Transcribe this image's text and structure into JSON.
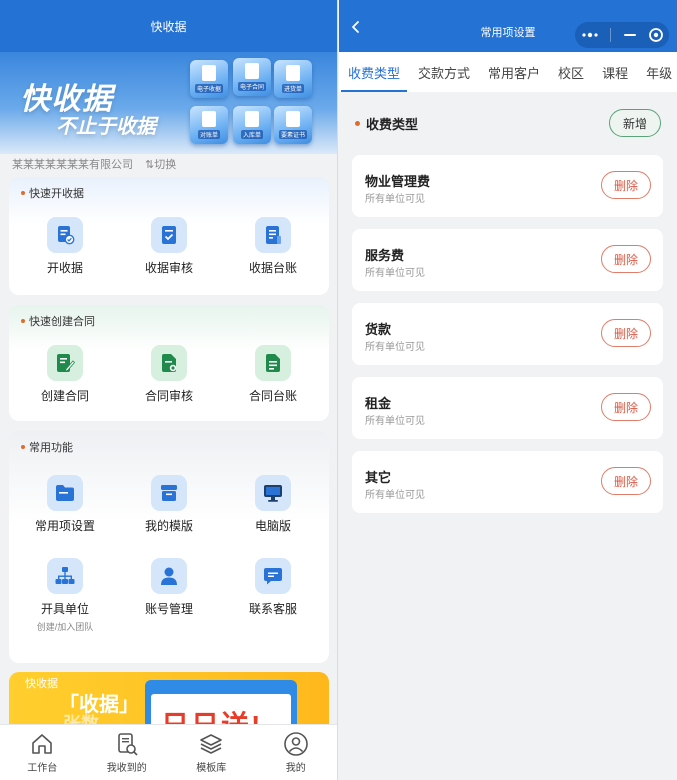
{
  "left": {
    "header_title": "快收据",
    "banner": {
      "title": "快收据",
      "subtitle": "不止于收据",
      "cubes": [
        "电子收据",
        "电子合同",
        "进货单",
        "对账单",
        "入库单",
        "要素证书"
      ]
    },
    "company": {
      "name": "某某某某某某某有限公司",
      "switch_label": "⇅切换"
    },
    "sections": [
      {
        "title": "快速开收据",
        "items": [
          {
            "label": "开收据",
            "icon": "receipt-icon"
          },
          {
            "label": "收据审核",
            "icon": "receipt-check-icon"
          },
          {
            "label": "收据台账",
            "icon": "receipt-ledger-icon"
          }
        ]
      },
      {
        "title": "快速创建合同",
        "items": [
          {
            "label": "创建合同",
            "icon": "contract-create-icon"
          },
          {
            "label": "合同审核",
            "icon": "contract-review-icon"
          },
          {
            "label": "合同台账",
            "icon": "contract-ledger-icon"
          }
        ]
      },
      {
        "title": "常用功能",
        "items": [
          {
            "label": "常用项设置",
            "icon": "folder-icon"
          },
          {
            "label": "我的模版",
            "icon": "template-box-icon"
          },
          {
            "label": "电脑版",
            "icon": "monitor-icon"
          },
          {
            "label": "开具单位",
            "sub": "创建/加入团队",
            "icon": "org-chart-icon"
          },
          {
            "label": "账号管理",
            "icon": "user-icon"
          },
          {
            "label": "联系客服",
            "icon": "chat-icon"
          }
        ]
      }
    ],
    "promo": {
      "tag": "快收据",
      "line1": "「收据」",
      "line2": "张数",
      "big": "日日送!"
    },
    "tabbar": [
      {
        "label": "工作台",
        "icon": "home-icon"
      },
      {
        "label": "我收到的",
        "icon": "received-doc-icon"
      },
      {
        "label": "模板库",
        "icon": "layers-icon"
      },
      {
        "label": "我的",
        "icon": "profile-icon"
      }
    ]
  },
  "right": {
    "header_title": "常用项设置",
    "tabs": [
      "收费类型",
      "交款方式",
      "常用客户",
      "校区",
      "课程",
      "年级"
    ],
    "active_tab": "收费类型",
    "section_title": "收费类型",
    "new_button": "新增",
    "items": [
      {
        "name": "物业管理费",
        "scope": "所有单位可见",
        "delete": "删除"
      },
      {
        "name": "服务费",
        "scope": "所有单位可见",
        "delete": "删除"
      },
      {
        "name": "货款",
        "scope": "所有单位可见",
        "delete": "删除"
      },
      {
        "name": "租金",
        "scope": "所有单位可见",
        "delete": "删除"
      },
      {
        "name": "其它",
        "scope": "所有单位可见",
        "delete": "删除"
      }
    ]
  },
  "colors": {
    "brand_blue": "#2472d4",
    "accent_orange": "#e56a2a",
    "delete_red": "#d95a45",
    "new_green": "#5aa37a"
  }
}
